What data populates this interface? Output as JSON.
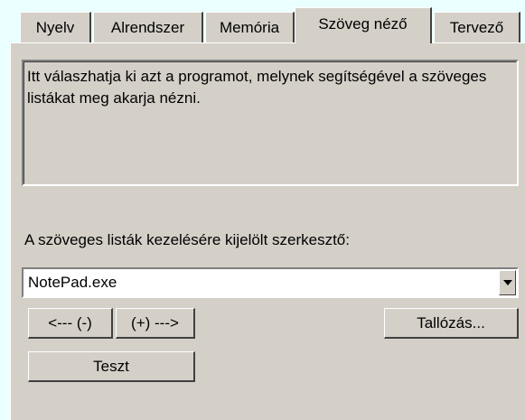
{
  "tabs": [
    {
      "label": "Nyelv"
    },
    {
      "label": "Alrendszer"
    },
    {
      "label": "Memória"
    },
    {
      "label": "Szöveg néző"
    },
    {
      "label": "Tervező"
    }
  ],
  "active_tab": "Szöveg néző",
  "description": "Itt válaszhatja ki azt a programot, melynek segítségével a szöveges listákat meg akarja nézni.",
  "editor_label": "A szöveges listák kezelésére kijelölt szerkesztő:",
  "editor_select": {
    "value": "NotePad.exe"
  },
  "buttons": {
    "prev": "<--- (-)",
    "next": "(+) --->",
    "browse": "Tallózás...",
    "test": "Teszt"
  }
}
